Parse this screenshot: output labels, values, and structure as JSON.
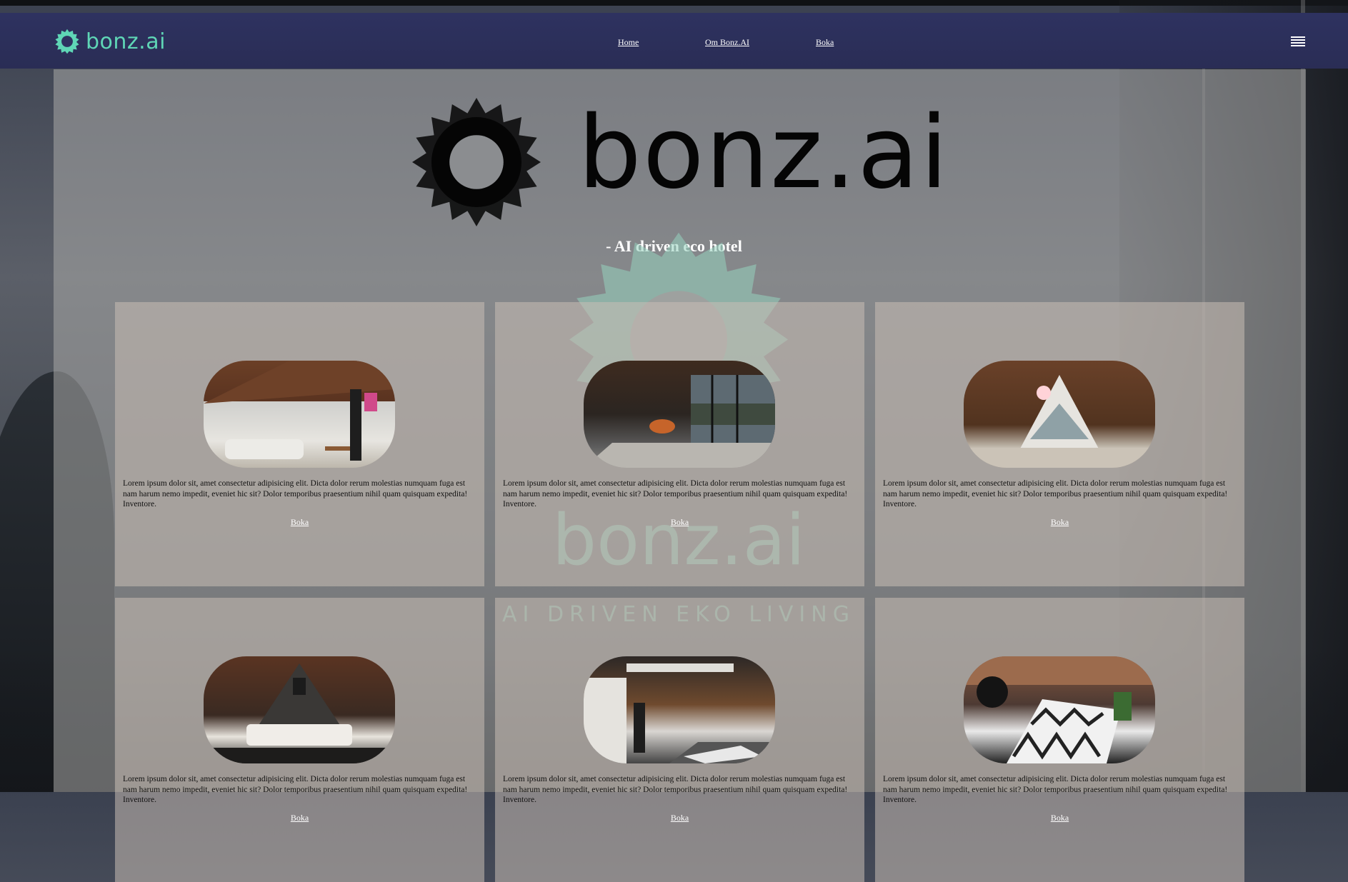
{
  "nav": {
    "brand": "bonz.ai",
    "links": [
      "Home",
      "Om Bonz.AI",
      "Boka"
    ]
  },
  "hero": {
    "logo_text": "bonz.ai",
    "tagline": "- AI driven eco hotel"
  },
  "watermark": {
    "word": "bonz.ai",
    "subtitle": "AI DRIVEN EKO LIVING"
  },
  "cards": [
    {
      "image": "loft-room-sofa-stairs",
      "text": "Lorem ipsum dolor sit, amet consectetur adipisicing elit. Dicta dolor rerum molestias numquam fuga est nam harum nemo impedit, eveniet hic sit? Dolor temporibus praesentium nihil quam quisquam expedita! Inventore.",
      "button": "Boka"
    },
    {
      "image": "living-room-fireplace-windows",
      "text": "Lorem ipsum dolor sit, amet consectetur adipisicing elit. Dicta dolor rerum molestias numquam fuga est nam harum nemo impedit, eveniet hic sit? Dolor temporibus praesentium nihil quam quisquam expedita! Inventore.",
      "button": "Boka"
    },
    {
      "image": "a-frame-bedroom-lake-view",
      "text": "Lorem ipsum dolor sit, amet consectetur adipisicing elit. Dicta dolor rerum molestias numquam fuga est nam harum nemo impedit, eveniet hic sit? Dolor temporibus praesentium nihil quam quisquam expedita! Inventore.",
      "button": "Boka"
    },
    {
      "image": "a-frame-bed",
      "text": "Lorem ipsum dolor sit, amet consectetur adipisicing elit. Dicta dolor rerum molestias numquam fuga est nam harum nemo impedit, eveniet hic sit? Dolor temporibus praesentium nihil quam quisquam expedita! Inventore.",
      "button": "Boka"
    },
    {
      "image": "loft-stairs-living",
      "text": "Lorem ipsum dolor sit, amet consectetur adipisicing elit. Dicta dolor rerum molestias numquam fuga est nam harum nemo impedit, eveniet hic sit? Dolor temporibus praesentium nihil quam quisquam expedita! Inventore.",
      "button": "Boka"
    },
    {
      "image": "top-view-chevron-rug",
      "text": "Lorem ipsum dolor sit, amet consectetur adipisicing elit. Dicta dolor rerum molestias numquam fuga est nam harum nemo impedit, eveniet hic sit? Dolor temporibus praesentium nihil quam quisquam expedita! Inventore.",
      "button": "Boka"
    }
  ],
  "colors": {
    "brand": "#5fd6b6",
    "navbar": "#2e3260",
    "watermark": "#96d2be"
  }
}
